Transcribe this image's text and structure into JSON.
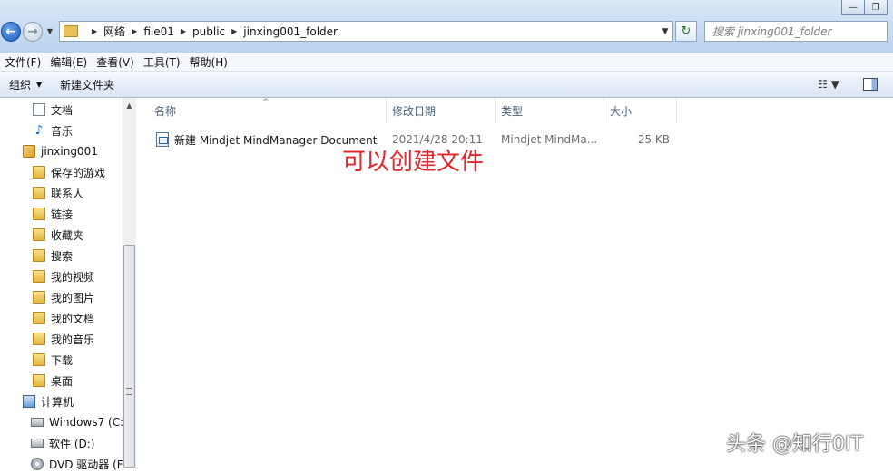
{
  "window": {
    "controls": {
      "minimize": "—",
      "maximize": "❐"
    }
  },
  "navigation": {
    "back": "←",
    "forward": "→",
    "recent": "▼"
  },
  "address": {
    "crumbs": [
      "网络",
      "file01",
      "public",
      "jinxing001_folder"
    ],
    "separator": "▶",
    "dropdown": "▼"
  },
  "refresh": "↻",
  "search": {
    "placeholder": "搜索 jinxing001_folder"
  },
  "menu": [
    "文件(F)",
    "编辑(E)",
    "查看(V)",
    "工具(T)",
    "帮助(H)"
  ],
  "toolbar": {
    "organize": "组织",
    "organize_arrow": "▼",
    "new_folder": "新建文件夹",
    "view_icon": "☷ ▼"
  },
  "nav_pane": {
    "items": [
      {
        "label": "文档",
        "icon": "document-icon"
      },
      {
        "label": "音乐",
        "icon": "music-icon"
      },
      {
        "label": "jinxing001",
        "icon": "user-folder-icon"
      },
      {
        "label": "保存的游戏",
        "icon": "folder-icon"
      },
      {
        "label": "联系人",
        "icon": "folder-icon"
      },
      {
        "label": "链接",
        "icon": "folder-icon"
      },
      {
        "label": "收藏夹",
        "icon": "folder-icon"
      },
      {
        "label": "搜索",
        "icon": "folder-icon"
      },
      {
        "label": "我的视频",
        "icon": "folder-icon"
      },
      {
        "label": "我的图片",
        "icon": "folder-icon"
      },
      {
        "label": "我的文档",
        "icon": "folder-icon"
      },
      {
        "label": "我的音乐",
        "icon": "folder-icon"
      },
      {
        "label": "下载",
        "icon": "folder-icon"
      },
      {
        "label": "桌面",
        "icon": "folder-icon"
      },
      {
        "label": "计算机",
        "icon": "computer-icon"
      },
      {
        "label": "Windows7 (C:",
        "icon": "drive-icon"
      },
      {
        "label": "软件 (D:)",
        "icon": "drive-icon"
      },
      {
        "label": "DVD 驱动器 (F",
        "icon": "dvd-icon"
      }
    ],
    "scroll_up": "▲"
  },
  "columns": {
    "name": "名称",
    "modified": "修改日期",
    "type": "类型",
    "size": "大小",
    "sort_indicator": "^"
  },
  "files": [
    {
      "name": "新建 Mindjet MindManager Document",
      "modified": "2021/4/28 20:11",
      "type": "Mindjet MindMa...",
      "size": "25 KB"
    }
  ],
  "annotation": "可以创建文件",
  "watermark": "头条 @知行0IT",
  "colors": {
    "annotation": "#e3262b",
    "header_text": "#4c607a"
  }
}
